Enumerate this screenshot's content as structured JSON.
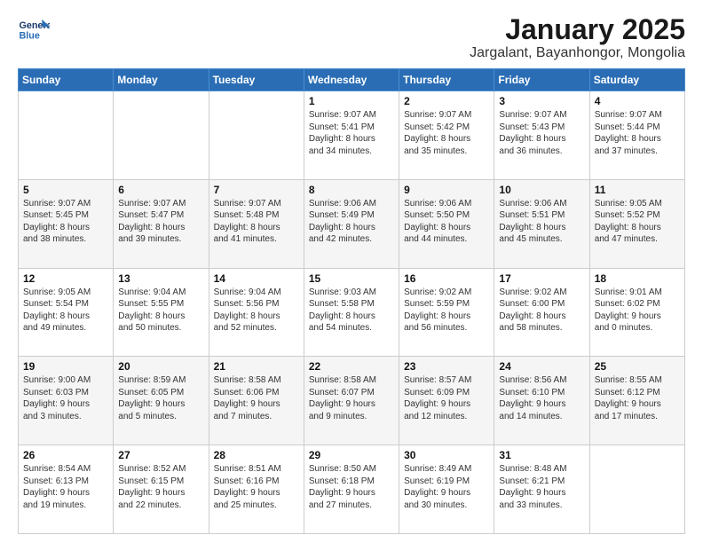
{
  "header": {
    "logo_line1": "General",
    "logo_line2": "Blue",
    "title": "January 2025",
    "subtitle": "Jargalant, Bayanhongor, Mongolia"
  },
  "weekdays": [
    "Sunday",
    "Monday",
    "Tuesday",
    "Wednesday",
    "Thursday",
    "Friday",
    "Saturday"
  ],
  "weeks": [
    [
      {
        "day": "",
        "info": ""
      },
      {
        "day": "",
        "info": ""
      },
      {
        "day": "",
        "info": ""
      },
      {
        "day": "1",
        "info": "Sunrise: 9:07 AM\nSunset: 5:41 PM\nDaylight: 8 hours\nand 34 minutes."
      },
      {
        "day": "2",
        "info": "Sunrise: 9:07 AM\nSunset: 5:42 PM\nDaylight: 8 hours\nand 35 minutes."
      },
      {
        "day": "3",
        "info": "Sunrise: 9:07 AM\nSunset: 5:43 PM\nDaylight: 8 hours\nand 36 minutes."
      },
      {
        "day": "4",
        "info": "Sunrise: 9:07 AM\nSunset: 5:44 PM\nDaylight: 8 hours\nand 37 minutes."
      }
    ],
    [
      {
        "day": "5",
        "info": "Sunrise: 9:07 AM\nSunset: 5:45 PM\nDaylight: 8 hours\nand 38 minutes."
      },
      {
        "day": "6",
        "info": "Sunrise: 9:07 AM\nSunset: 5:47 PM\nDaylight: 8 hours\nand 39 minutes."
      },
      {
        "day": "7",
        "info": "Sunrise: 9:07 AM\nSunset: 5:48 PM\nDaylight: 8 hours\nand 41 minutes."
      },
      {
        "day": "8",
        "info": "Sunrise: 9:06 AM\nSunset: 5:49 PM\nDaylight: 8 hours\nand 42 minutes."
      },
      {
        "day": "9",
        "info": "Sunrise: 9:06 AM\nSunset: 5:50 PM\nDaylight: 8 hours\nand 44 minutes."
      },
      {
        "day": "10",
        "info": "Sunrise: 9:06 AM\nSunset: 5:51 PM\nDaylight: 8 hours\nand 45 minutes."
      },
      {
        "day": "11",
        "info": "Sunrise: 9:05 AM\nSunset: 5:52 PM\nDaylight: 8 hours\nand 47 minutes."
      }
    ],
    [
      {
        "day": "12",
        "info": "Sunrise: 9:05 AM\nSunset: 5:54 PM\nDaylight: 8 hours\nand 49 minutes."
      },
      {
        "day": "13",
        "info": "Sunrise: 9:04 AM\nSunset: 5:55 PM\nDaylight: 8 hours\nand 50 minutes."
      },
      {
        "day": "14",
        "info": "Sunrise: 9:04 AM\nSunset: 5:56 PM\nDaylight: 8 hours\nand 52 minutes."
      },
      {
        "day": "15",
        "info": "Sunrise: 9:03 AM\nSunset: 5:58 PM\nDaylight: 8 hours\nand 54 minutes."
      },
      {
        "day": "16",
        "info": "Sunrise: 9:02 AM\nSunset: 5:59 PM\nDaylight: 8 hours\nand 56 minutes."
      },
      {
        "day": "17",
        "info": "Sunrise: 9:02 AM\nSunset: 6:00 PM\nDaylight: 8 hours\nand 58 minutes."
      },
      {
        "day": "18",
        "info": "Sunrise: 9:01 AM\nSunset: 6:02 PM\nDaylight: 9 hours\nand 0 minutes."
      }
    ],
    [
      {
        "day": "19",
        "info": "Sunrise: 9:00 AM\nSunset: 6:03 PM\nDaylight: 9 hours\nand 3 minutes."
      },
      {
        "day": "20",
        "info": "Sunrise: 8:59 AM\nSunset: 6:05 PM\nDaylight: 9 hours\nand 5 minutes."
      },
      {
        "day": "21",
        "info": "Sunrise: 8:58 AM\nSunset: 6:06 PM\nDaylight: 9 hours\nand 7 minutes."
      },
      {
        "day": "22",
        "info": "Sunrise: 8:58 AM\nSunset: 6:07 PM\nDaylight: 9 hours\nand 9 minutes."
      },
      {
        "day": "23",
        "info": "Sunrise: 8:57 AM\nSunset: 6:09 PM\nDaylight: 9 hours\nand 12 minutes."
      },
      {
        "day": "24",
        "info": "Sunrise: 8:56 AM\nSunset: 6:10 PM\nDaylight: 9 hours\nand 14 minutes."
      },
      {
        "day": "25",
        "info": "Sunrise: 8:55 AM\nSunset: 6:12 PM\nDaylight: 9 hours\nand 17 minutes."
      }
    ],
    [
      {
        "day": "26",
        "info": "Sunrise: 8:54 AM\nSunset: 6:13 PM\nDaylight: 9 hours\nand 19 minutes."
      },
      {
        "day": "27",
        "info": "Sunrise: 8:52 AM\nSunset: 6:15 PM\nDaylight: 9 hours\nand 22 minutes."
      },
      {
        "day": "28",
        "info": "Sunrise: 8:51 AM\nSunset: 6:16 PM\nDaylight: 9 hours\nand 25 minutes."
      },
      {
        "day": "29",
        "info": "Sunrise: 8:50 AM\nSunset: 6:18 PM\nDaylight: 9 hours\nand 27 minutes."
      },
      {
        "day": "30",
        "info": "Sunrise: 8:49 AM\nSunset: 6:19 PM\nDaylight: 9 hours\nand 30 minutes."
      },
      {
        "day": "31",
        "info": "Sunrise: 8:48 AM\nSunset: 6:21 PM\nDaylight: 9 hours\nand 33 minutes."
      },
      {
        "day": "",
        "info": ""
      }
    ]
  ]
}
